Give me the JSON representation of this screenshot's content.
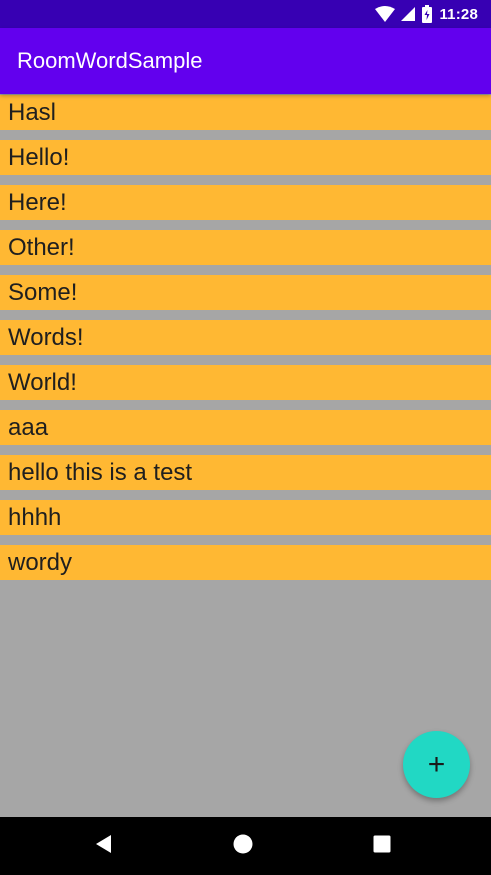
{
  "status_bar": {
    "time": "11:28",
    "icons": [
      "wifi-icon",
      "signal-icon",
      "battery-icon"
    ]
  },
  "app_bar": {
    "title": "RoomWordSample"
  },
  "words": [
    "Hasl",
    "Hello!",
    "Here!",
    "Other!",
    "Some!",
    "Words!",
    "World!",
    "aaa",
    "hello this is a test",
    "hhhh",
    "wordy"
  ],
  "fab": {
    "icon": "plus-icon",
    "label": "+"
  },
  "nav_bar": {
    "icons": [
      "back-icon",
      "home-icon",
      "recents-icon"
    ]
  },
  "colors": {
    "status_bar": "#3700B3",
    "app_bar": "#6200EE",
    "list_item": "#FFB833",
    "background": "#A6A6A6",
    "fab": "#21D8C4",
    "nav_bar": "#000000"
  }
}
